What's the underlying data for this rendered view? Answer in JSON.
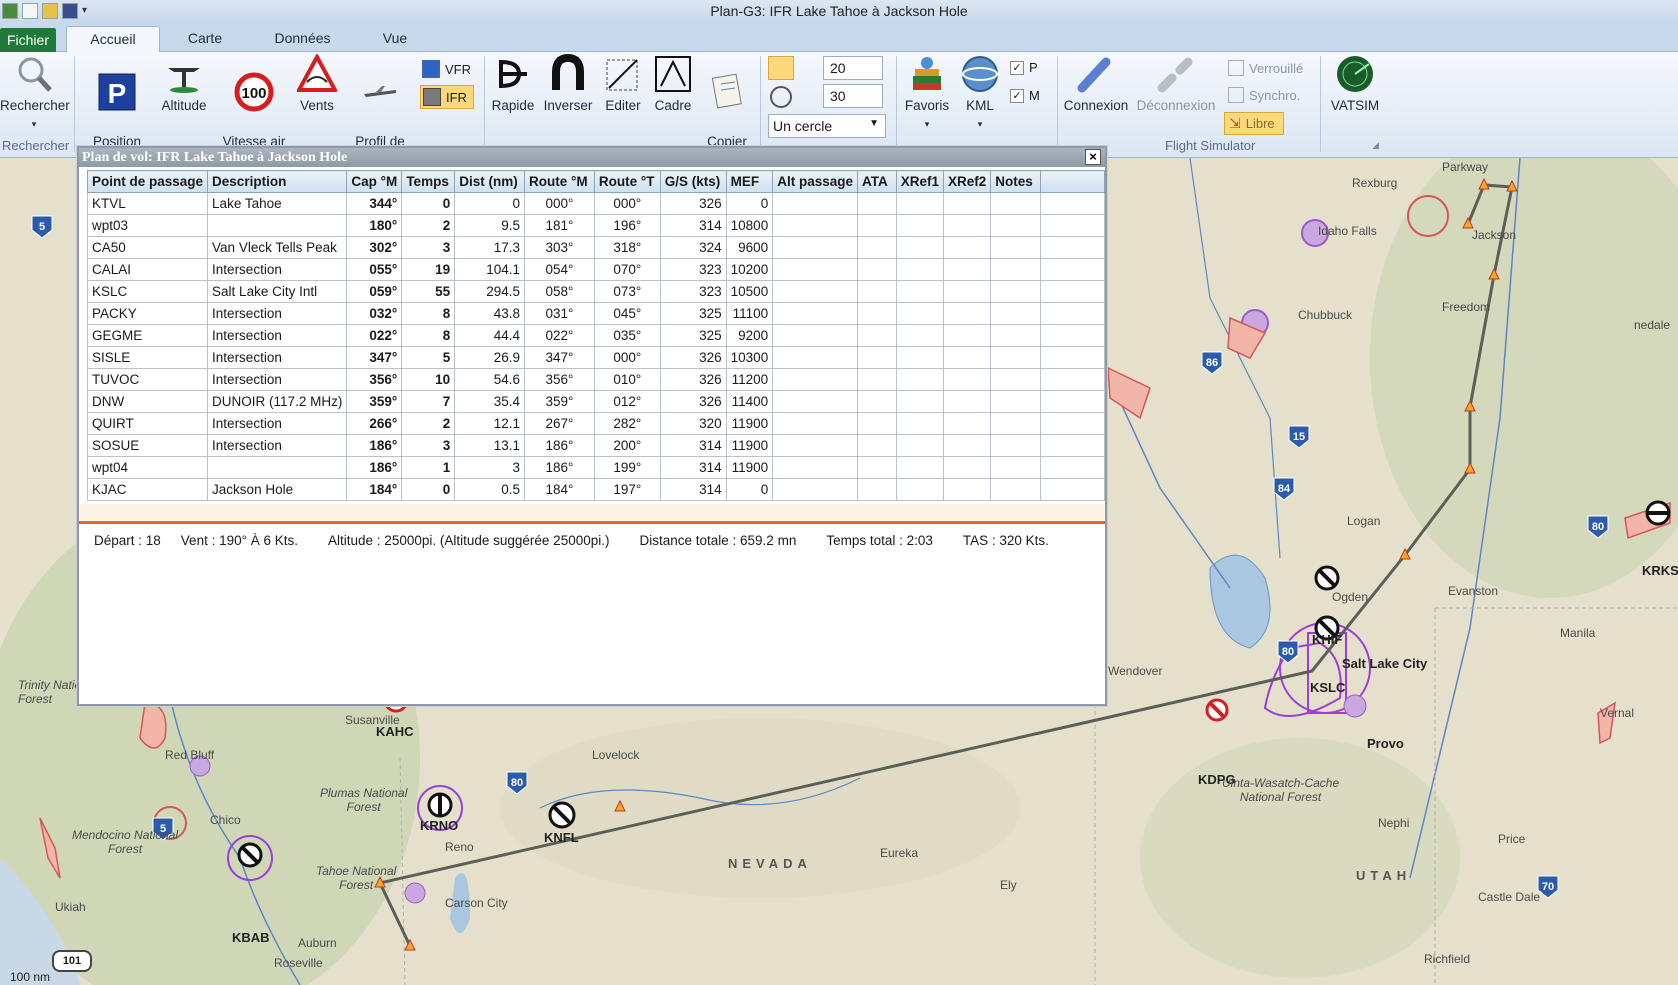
{
  "window": {
    "title": "Plan-G3: IFR Lake Tahoe à Jackson Hole"
  },
  "tabs": [
    "Fichier",
    "Accueil",
    "Carte",
    "Données",
    "Vue"
  ],
  "ribbon": {
    "search": "Rechercher",
    "search_group": "Rechercher",
    "position": "Position\nde départ",
    "altitude": "Altitude",
    "airspeed": "Vitesse air\n(Airspeed)",
    "winds": "Vents",
    "aircraft_profile": "Profil de\nl'Appareil",
    "vfr": "VFR",
    "ifr": "IFR",
    "rapide": "Rapide",
    "inverser": "Inverser",
    "editer": "Editer",
    "cadre": "Cadre",
    "copier": "Copier\nRoute",
    "num1": "20",
    "num2": "30",
    "circle_select": "Un cercle",
    "favoris": "Favoris",
    "kml": "KML",
    "p": "P",
    "m": "M",
    "connexion": "Connexion",
    "deconnexion": "Déconnexion",
    "verrouille": "Verrouillé",
    "synchro": "Synchro.",
    "libre": "Libre",
    "fs_group": "Flight Simulator",
    "vatsim": "VATSIM"
  },
  "flight_plan": {
    "title": "Plan de vol: IFR Lake Tahoe à Jackson Hole",
    "columns": [
      "Point de passage",
      "Description",
      "Cap °M",
      "Temps",
      "Dist (nm)",
      "Route °M",
      "Route °T",
      "G/S (kts)",
      "MEF",
      "Alt passage",
      "ATA",
      "XRef1",
      "XRef2",
      "Notes"
    ],
    "rows": [
      [
        "KTVL",
        "Lake Tahoe",
        "344°",
        "0",
        "0",
        "000°",
        "000°",
        "326",
        "0"
      ],
      [
        "wpt03",
        "",
        "180°",
        "2",
        "9.5",
        "181°",
        "196°",
        "314",
        "10800"
      ],
      [
        "CA50",
        "Van Vleck Tells Peak",
        "302°",
        "3",
        "17.3",
        "303°",
        "318°",
        "324",
        "9600"
      ],
      [
        "CALAI",
        "Intersection",
        "055°",
        "19",
        "104.1",
        "054°",
        "070°",
        "323",
        "10200"
      ],
      [
        "KSLC",
        "Salt Lake City Intl",
        "059°",
        "55",
        "294.5",
        "058°",
        "073°",
        "323",
        "10500"
      ],
      [
        "PACKY",
        "Intersection",
        "032°",
        "8",
        "43.8",
        "031°",
        "045°",
        "325",
        "11100"
      ],
      [
        "GEGME",
        "Intersection",
        "022°",
        "8",
        "44.4",
        "022°",
        "035°",
        "325",
        "9200"
      ],
      [
        "SISLE",
        "Intersection",
        "347°",
        "5",
        "26.9",
        "347°",
        "000°",
        "326",
        "10300"
      ],
      [
        "TUVOC",
        "Intersection",
        "356°",
        "10",
        "54.6",
        "356°",
        "010°",
        "326",
        "11200"
      ],
      [
        "DNW",
        "DUNOIR (117.2 MHz)",
        "359°",
        "7",
        "35.4",
        "359°",
        "012°",
        "326",
        "11400"
      ],
      [
        "QUIRT",
        "Intersection",
        "266°",
        "2",
        "12.1",
        "267°",
        "282°",
        "320",
        "11900"
      ],
      [
        "SOSUE",
        "Intersection",
        "186°",
        "3",
        "13.1",
        "186°",
        "200°",
        "314",
        "11900"
      ],
      [
        "wpt04",
        "",
        "186°",
        "1",
        "3",
        "186°",
        "199°",
        "314",
        "11900"
      ],
      [
        "KJAC",
        "Jackson Hole",
        "184°",
        "0",
        "0.5",
        "184°",
        "197°",
        "314",
        "0"
      ]
    ],
    "summary": {
      "depart": "Départ :  18",
      "vent": "Vent :  190° À 6 Kts.",
      "altitude": "Altitude :  25000pi. (Altitude suggérée 25000pi.)",
      "distance": "Distance totale :  659.2 mn",
      "temps": "Temps total :  2:03",
      "tas": "TAS :  320 Kts."
    }
  },
  "map": {
    "labels": {
      "rexburg": "Rexburg",
      "idaho_falls": "Idaho Falls",
      "jackson": "Jackson",
      "freedom": "Freedom",
      "chubbuck": "Chubbuck",
      "logan": "Logan",
      "ogden": "Ogden",
      "evanston": "Evanston",
      "manila": "Manila",
      "slc": "Salt Lake City",
      "provo": "Provo",
      "vernal": "Vernal",
      "nephi": "Nephi",
      "price": "Price",
      "castle_dale": "Castle Dale",
      "richfield": "Richfield",
      "eureka": "Eureka",
      "ely": "Ely",
      "lovelock": "Lovelock",
      "susanville": "Susanville",
      "red_bluff": "Red Bluff",
      "chico": "Chico",
      "reno": "Reno",
      "carson": "Carson City",
      "roseville": "Roseville",
      "auburn": "Auburn",
      "ukiah": "Ukiah",
      "wendover": "Wendover",
      "nevada": "NEVADA",
      "utah": "UTAH",
      "kaho": "KAHC",
      "knfl": "KNFL",
      "krno": "KRNO",
      "kbab": "KBAB",
      "kdpg": "KDPG",
      "krks": "KRKS",
      "khif": "KHIF",
      "kslc": "KSLC",
      "plumas": "Plumas National\nForest",
      "tahoe_nf": "Tahoe National\nForest",
      "mendocino": "Mendocino National\nForest",
      "uinta": "Uinta-Wasatch-Cache\nNational Forest",
      "trinity": "Trinity Natio\nForest",
      "parkway": "Parkway",
      "lonedale": "nedale",
      "scale": "100 nm",
      "i5": "5",
      "i15": "15",
      "i84": "84",
      "i80": "80",
      "i86": "86",
      "i70": "70",
      "us101": "101"
    }
  }
}
